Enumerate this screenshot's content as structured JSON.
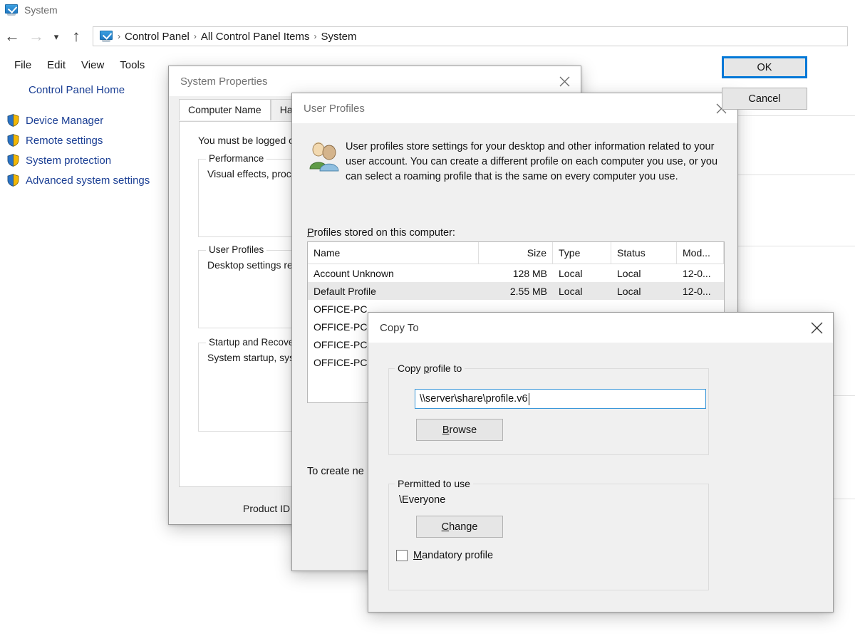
{
  "window": {
    "title": "System",
    "icon": "system-monitor-icon"
  },
  "navbar": {
    "back_icon": "back-arrow-icon",
    "forward_icon": "forward-arrow-icon",
    "recent_icon": "chevron-down-icon",
    "up_icon": "up-arrow-icon",
    "address_icon": "system-monitor-icon",
    "breadcrumbs": [
      "Control Panel",
      "All Control Panel Items",
      "System"
    ],
    "separator": "›"
  },
  "menubar": {
    "items": [
      "File",
      "Edit",
      "View",
      "Tools"
    ]
  },
  "sidebar": {
    "home_label": "Control Panel Home",
    "items": [
      {
        "label": "Device Manager",
        "icon": "shield-icon"
      },
      {
        "label": "Remote settings",
        "icon": "shield-icon"
      },
      {
        "label": "System protection",
        "icon": "shield-icon"
      },
      {
        "label": "Advanced system settings",
        "icon": "shield-icon"
      }
    ]
  },
  "system_properties": {
    "title": "System Properties",
    "close_icon": "close-icon",
    "tabs": [
      {
        "label": "Computer Name",
        "active": true
      },
      {
        "label": "Hard",
        "active": false
      }
    ],
    "note": "You must be logged o",
    "groups": [
      {
        "label": "Performance",
        "text": "Visual effects, proce"
      },
      {
        "label": "User Profiles",
        "text": "Desktop settings rel"
      },
      {
        "label": "Startup and Recove",
        "text": "System startup, syst"
      }
    ],
    "product_id": "Product ID"
  },
  "user_profiles": {
    "title": "User Profiles",
    "close_icon": "close-icon",
    "people_icon": "user-profiles-people-icon",
    "description": "User profiles store settings for your desktop and other information related to your user account. You can create a different profile on each computer you use, or you can select a roaming profile that is the same on every computer you use.",
    "list_label": "Profiles stored on this computer:",
    "list_label_accel": "P",
    "columns": [
      "Name",
      "Size",
      "Type",
      "Status",
      "Mod..."
    ],
    "rows": [
      {
        "name": "Account Unknown",
        "size": "128 MB",
        "type": "Local",
        "status": "Local",
        "modified": "12-0...",
        "selected": false
      },
      {
        "name": "Default Profile",
        "size": "2.55 MB",
        "type": "Local",
        "status": "Local",
        "modified": "12-0...",
        "selected": true
      },
      {
        "name": "OFFICE-PC",
        "size": "",
        "type": "",
        "status": "",
        "modified": "",
        "selected": false
      },
      {
        "name": "OFFICE-PC",
        "size": "",
        "type": "",
        "status": "",
        "modified": "",
        "selected": false
      },
      {
        "name": "OFFICE-PC",
        "size": "",
        "type": "",
        "status": "",
        "modified": "",
        "selected": false
      },
      {
        "name": "OFFICE-PC",
        "size": "",
        "type": "",
        "status": "",
        "modified": "",
        "selected": false
      }
    ],
    "footnote": "To create ne"
  },
  "copy_to": {
    "title": "Copy To",
    "close_icon": "close-icon",
    "copy_profile_group_label": "Copy profile to",
    "copy_profile_accel_before": "Copy ",
    "copy_profile_accel": "p",
    "copy_profile_accel_after": "rofile to",
    "path_value": "\\\\server\\share\\profile.v6",
    "browse_label_before": "",
    "browse_accel": "B",
    "browse_label_after": "rowse",
    "permitted_group_label": "Permitted to use",
    "permitted_value": "\\Everyone",
    "change_accel": "C",
    "change_label_after": "hange",
    "mandatory_accel": "M",
    "mandatory_label_after": "andatory profile",
    "mandatory_checked": false,
    "ok_label": "OK",
    "cancel_label": "Cancel"
  },
  "colors": {
    "link": "#1b3f94",
    "accent": "#0078d7",
    "dialog_bg": "#f0f0f0",
    "selection": "#e8e8e8"
  }
}
